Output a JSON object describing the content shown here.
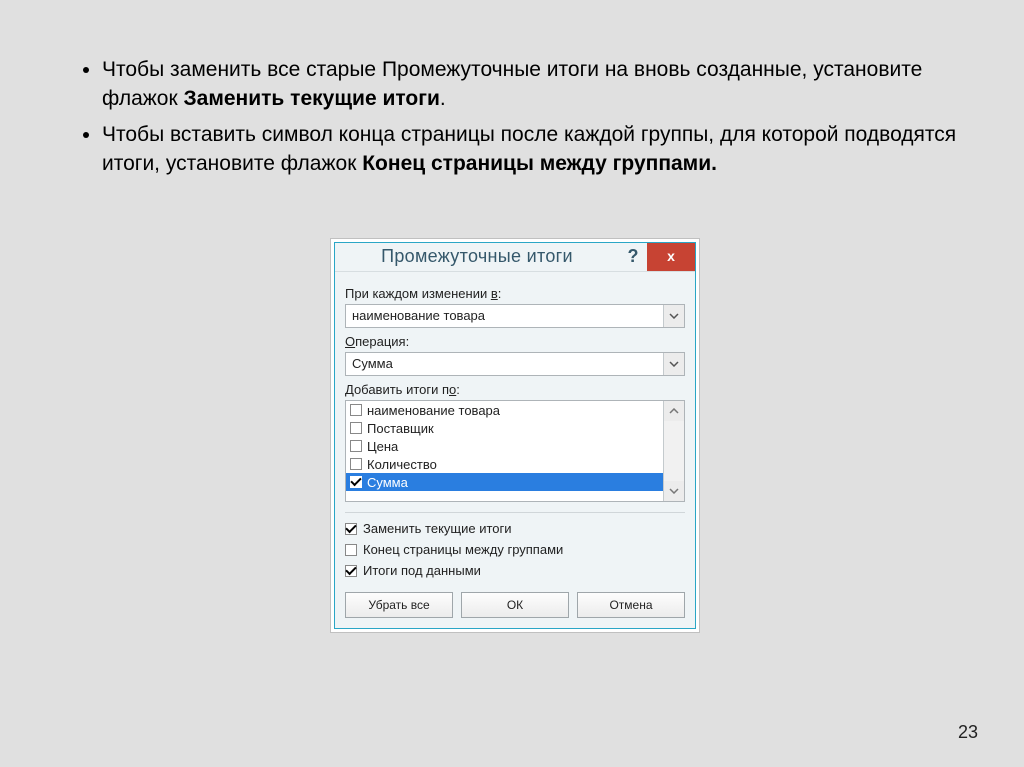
{
  "bullets": [
    {
      "pre": "Чтобы заменить все старые Промежуточные итоги на вновь созданные, установите флажок ",
      "bold": "Заменить текущие итоги",
      "post": "."
    },
    {
      "pre": "Чтобы вставить символ конца страницы после каждой группы, для которой подводятся итоги, установите флажок ",
      "bold": "Конец страницы между группами.",
      "post": ""
    }
  ],
  "dialog": {
    "title": "Промежуточные итоги",
    "help": "?",
    "close": "x",
    "labels": {
      "change_in_prefix": "При каждом изменении ",
      "change_in_ul": "в",
      "change_in_suffix": ":",
      "operation_ul": "О",
      "operation_rest": "перация:",
      "add_totals_prefix": "Добавить итоги п",
      "add_totals_ul": "о",
      "add_totals_suffix": ":"
    },
    "change_in_value": "наименование товара",
    "operation_value": "Сумма",
    "items": [
      {
        "label": "наименование товара",
        "checked": false,
        "selected": false
      },
      {
        "label": "Поставщик",
        "checked": false,
        "selected": false
      },
      {
        "label": "Цена",
        "checked": false,
        "selected": false
      },
      {
        "label": "Количество",
        "checked": false,
        "selected": false
      },
      {
        "label": "Сумма",
        "checked": true,
        "selected": true
      }
    ],
    "options": {
      "replace": {
        "ul": "З",
        "rest": "аменить текущие итоги",
        "checked": true
      },
      "pagebreak": {
        "ul": "К",
        "rest": "онец страницы между группами",
        "checked": false
      },
      "below": {
        "ul": "И",
        "rest": "тоги под данными",
        "checked": true
      }
    },
    "buttons": {
      "remove": "Убрать все",
      "ok": "ОК",
      "cancel": "Отмена"
    }
  },
  "page_number": "23"
}
